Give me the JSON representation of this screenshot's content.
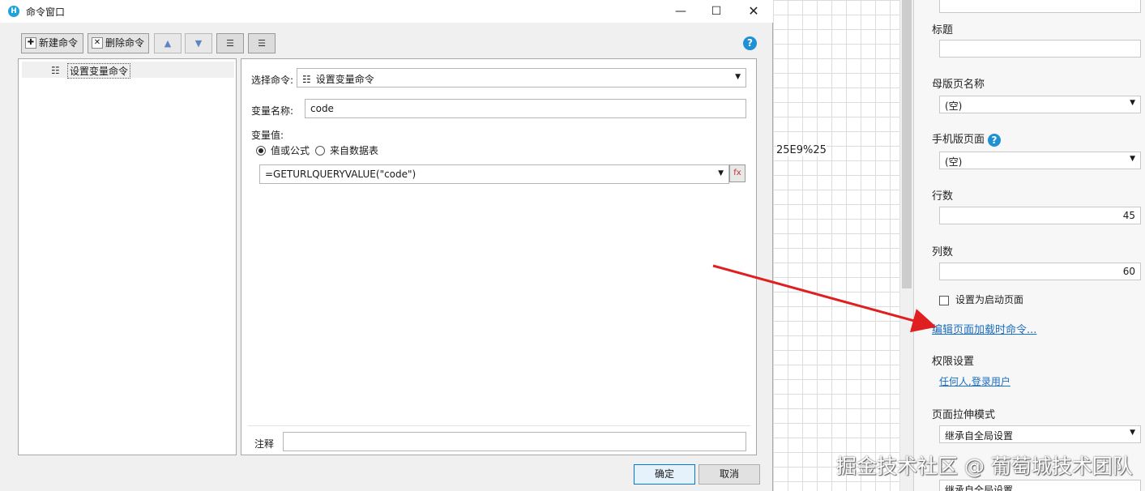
{
  "background": {
    "grid_text": "25E9%25",
    "props": {
      "title_label": "标题",
      "title_value": "",
      "master_label": "母版页名称",
      "master_value": "(空)",
      "mobile_label": "手机版页面",
      "mobile_value": "(空)",
      "rows_label": "行数",
      "rows_value": "45",
      "cols_label": "列数",
      "cols_value": "60",
      "startup_label": "设置为启动页面",
      "edit_load_link": "编辑页面加载时命令...",
      "permission_label": "权限设置",
      "permission_link": "任何人,登录用户",
      "stretch_label": "页面拉伸模式",
      "stretch_value": "继承自全局设置",
      "next_value": "继承自全局设置"
    },
    "watermark": "掘金技术社区 @ 葡萄城技术团队"
  },
  "dialog": {
    "title": "命令窗口",
    "toolbar": {
      "new_label": "新建命令",
      "delete_label": "删除命令"
    },
    "tree": {
      "items": [
        {
          "label": "设置变量命令"
        }
      ]
    },
    "panel": {
      "select_cmd_label": "选择命令:",
      "select_cmd_value": "设置变量命令",
      "var_name_label": "变量名称:",
      "var_name_value": "code",
      "var_value_label": "变量值:",
      "radio_formula": "值或公式",
      "radio_table": "来自数据表",
      "formula_value": "=GETURLQUERYVALUE(\"code\")",
      "comment_label": "注释",
      "comment_value": ""
    },
    "buttons": {
      "ok": "确定",
      "cancel": "取消"
    }
  },
  "colors": {
    "accent": "#1e90d6",
    "arrow": "#e02020",
    "link": "#1a6ec2"
  }
}
